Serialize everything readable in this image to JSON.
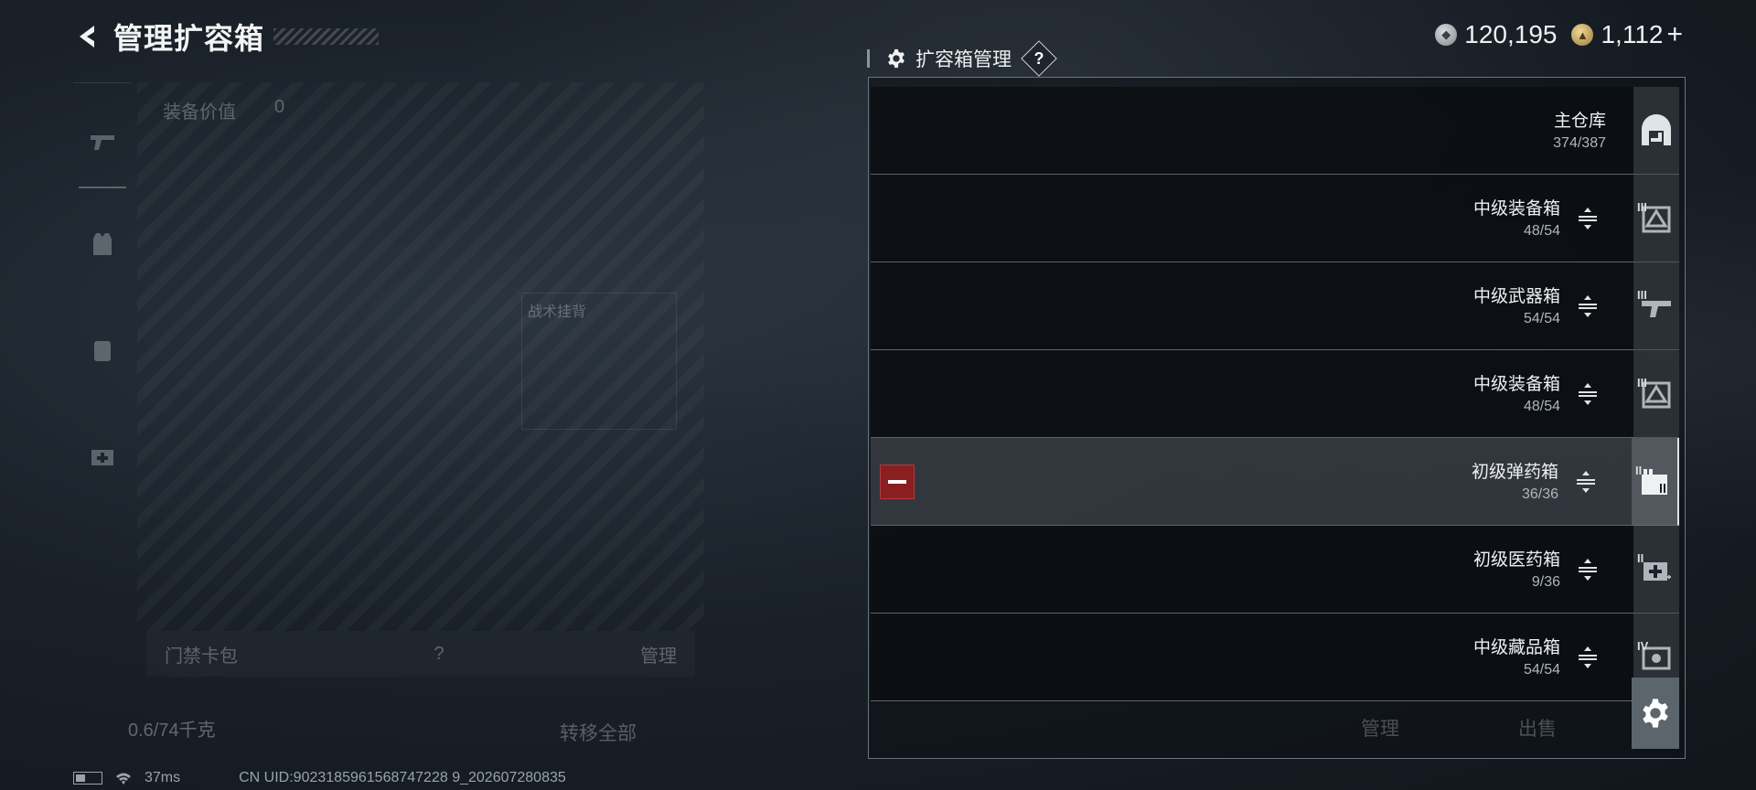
{
  "header": {
    "title": "管理扩容箱"
  },
  "currency": {
    "silver": "120,195",
    "gold": "1,112",
    "plus": "+"
  },
  "left_panel": {
    "equip_value_label": "装备价值",
    "equip_value": "0",
    "tactical_label": "战术挂背",
    "card_bag_label": "门禁卡包",
    "card_bag_help": "?",
    "card_bag_manage": "管理",
    "weight": "0.6/74千克",
    "transfer_all": "转移全部"
  },
  "status": {
    "ping": "37ms",
    "uid": "CN UID:9023185961568747228 9_202607280835"
  },
  "panel": {
    "title": "扩容箱管理",
    "help": "?",
    "rows": [
      {
        "name": "主仓库",
        "count": "374/387",
        "type": "main"
      },
      {
        "name": "中级装备箱",
        "count": "48/54",
        "tier": "III"
      },
      {
        "name": "中级武器箱",
        "count": "54/54",
        "tier": "III"
      },
      {
        "name": "中级装备箱",
        "count": "48/54",
        "tier": "III"
      },
      {
        "name": "初级弹药箱",
        "count": "36/36",
        "tier": "II",
        "selected": true
      },
      {
        "name": "初级医药箱",
        "count": "9/36",
        "tier": "II"
      },
      {
        "name": "中级藏品箱",
        "count": "54/54",
        "tier": "IV"
      }
    ],
    "footer": {
      "manage": "管理",
      "sell": "出售"
    }
  },
  "colors": {
    "remove_red": "#8a1f22",
    "border": "#6b757c"
  },
  "icons": [
    "back-arrow-icon",
    "gear-icon",
    "drag-handle-icon",
    "remove-icon",
    "warehouse-icon",
    "question-icon"
  ]
}
